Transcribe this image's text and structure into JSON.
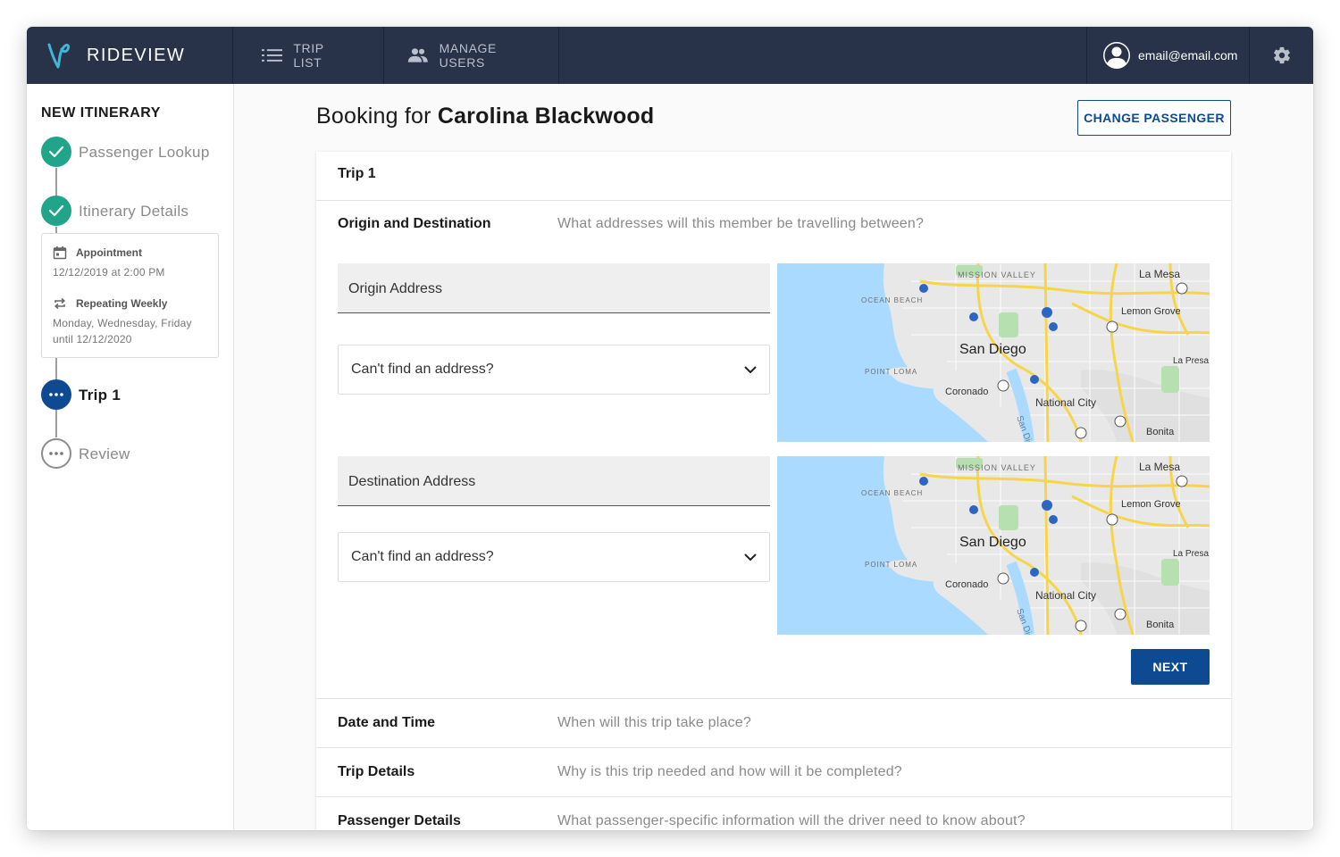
{
  "app": {
    "name": "RIDEVIEW",
    "logo_icon": "rideview-logo-icon"
  },
  "nav": {
    "trip_list": "TRIP LIST",
    "manage_users": "MANAGE USERS"
  },
  "user": {
    "email": "email@email.com"
  },
  "sidebar": {
    "title": "NEW ITINERARY",
    "steps": [
      {
        "label": "Passenger Lookup",
        "status": "done"
      },
      {
        "label": "Itinerary Details",
        "status": "done"
      },
      {
        "label": "Trip 1",
        "status": "active"
      },
      {
        "label": "Review",
        "status": "todo"
      }
    ],
    "summary": {
      "appointment_title": "Appointment",
      "appointment_value": "12/12/2019 at 2:00 PM",
      "repeat_title": "Repeating Weekly",
      "repeat_days": "Monday, Wednesday, Friday",
      "repeat_until": "until 12/12/2020"
    }
  },
  "header": {
    "booking_prefix": "Booking for",
    "passenger_name": "Carolina Blackwood",
    "change_button": "CHANGE PASSENGER"
  },
  "trip": {
    "title": "Trip 1",
    "origin_section": {
      "title": "Origin and Destination",
      "description": "What addresses will this member be travelling between?"
    },
    "origin_placeholder": "Origin Address",
    "destination_placeholder": "Destination Address",
    "cant_find": "Can't find an address?",
    "next_button": "NEXT",
    "map_labels": {
      "mission_valley": "MISSION VALLEY",
      "la_mesa": "La Mesa",
      "ocean_beach": "OCEAN BEACH",
      "lemon_grove": "Lemon Grove",
      "san_diego": "San Diego",
      "point_loma": "POINT LOMA",
      "la_presa": "La Presa",
      "coronado": "Coronado",
      "national_city": "National City",
      "bonita": "Bonita",
      "san_diego_bay": "San Die"
    },
    "sections": [
      {
        "title": "Date and Time",
        "description": "When will this trip take place?"
      },
      {
        "title": "Trip Details",
        "description": "Why is this trip needed and how will it be completed?"
      },
      {
        "title": "Passenger Details",
        "description": "What passenger-specific information will the driver need to know about?"
      }
    ]
  },
  "colors": {
    "topbar": "#283249",
    "accent": "#0d4a92",
    "success": "#21a58a",
    "logo": "#3fb8d8"
  }
}
